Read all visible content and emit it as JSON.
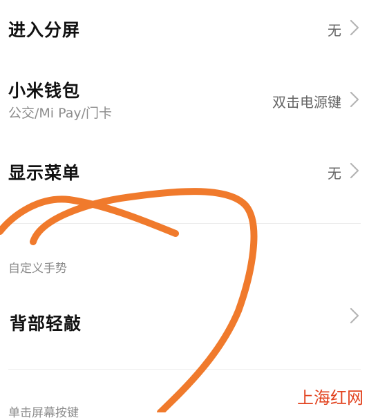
{
  "settings": {
    "split_screen": {
      "title": "进入分屏",
      "value": "无"
    },
    "mi_wallet": {
      "title": "小米钱包",
      "subtitle": "公交/Mi Pay/门卡",
      "value": "双击电源键"
    },
    "show_menu": {
      "title": "显示菜单",
      "value": "无"
    },
    "custom_gestures_label": "自定义手势",
    "back_tap": {
      "title": "背部轻敲"
    },
    "single_hand_label": "单击屏幕按键"
  },
  "watermark": "上海红网",
  "icons": {
    "chevron": "chevron-right-icon"
  },
  "colors": {
    "scribble": "#f07a2c",
    "watermark": "#e2431f"
  }
}
